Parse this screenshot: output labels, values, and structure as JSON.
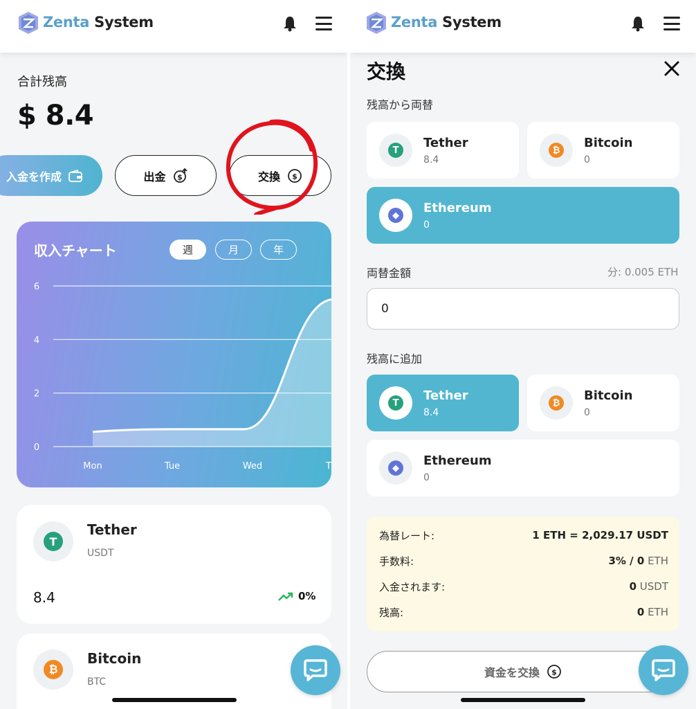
{
  "brand": {
    "name_part1": "Zenta",
    "name_part2": "System"
  },
  "left": {
    "total_label": "合計残高",
    "total_value": "$ 8.4",
    "buttons": {
      "deposit": "入金を作成",
      "withdraw": "出金",
      "exchange": "交換"
    },
    "chart": {
      "title": "収入チャート",
      "periods": [
        {
          "label": "週",
          "active": true
        },
        {
          "label": "月",
          "active": false
        },
        {
          "label": "年",
          "active": false
        }
      ],
      "yticks": [
        "6",
        "4",
        "2",
        "0"
      ],
      "xticks": [
        "Mon",
        "Tue",
        "Wed",
        "T"
      ]
    },
    "assets": [
      {
        "name": "Tether",
        "symbol": "USDT",
        "balance": "8.4",
        "change": "0%",
        "icon": "tether-icon"
      },
      {
        "name": "Bitcoin",
        "symbol": "BTC",
        "icon": "bitcoin-icon"
      }
    ]
  },
  "chart_data": {
    "type": "line",
    "title": "収入チャート",
    "x": [
      "Mon",
      "Tue",
      "Wed",
      "Thu"
    ],
    "series": [
      {
        "values": [
          0.55,
          0.65,
          0.65,
          5.5
        ]
      }
    ],
    "ylim": [
      0,
      6
    ],
    "yticks": [
      0,
      2,
      4,
      6
    ],
    "grid": true
  },
  "right": {
    "title": "交換",
    "from_label": "残高から両替",
    "from_options": [
      {
        "name": "Tether",
        "balance": "8.4",
        "selected": false
      },
      {
        "name": "Bitcoin",
        "balance": "0",
        "selected": false
      },
      {
        "name": "Ethereum",
        "balance": "0",
        "selected": true
      }
    ],
    "amount_label": "両替金額",
    "amount_hint": "分: 0.005 ETH",
    "amount_value": "0",
    "to_label": "残高に追加",
    "to_options": [
      {
        "name": "Tether",
        "balance": "8.4",
        "selected": true
      },
      {
        "name": "Bitcoin",
        "balance": "0",
        "selected": false
      },
      {
        "name": "Ethereum",
        "balance": "0",
        "selected": false
      }
    ],
    "info": {
      "rate_label": "為替レート:",
      "rate_value": "1 ETH = 2,029.17 USDT",
      "fee_label": "手数料:",
      "fee_num": "3% / 0",
      "fee_unit": "ETH",
      "credit_label": "入金されます:",
      "credit_num": "0",
      "credit_unit": "USDT",
      "balance_label": "残高:",
      "balance_num": "0",
      "balance_unit": "ETH"
    },
    "swap_button": "資金を交換"
  },
  "colors": {
    "accent": "#52b6d0",
    "annotation_circle": "#e0141e",
    "tether": "#26a17b",
    "bitcoin": "#f08a24",
    "ethereum": "#5f74d8"
  }
}
